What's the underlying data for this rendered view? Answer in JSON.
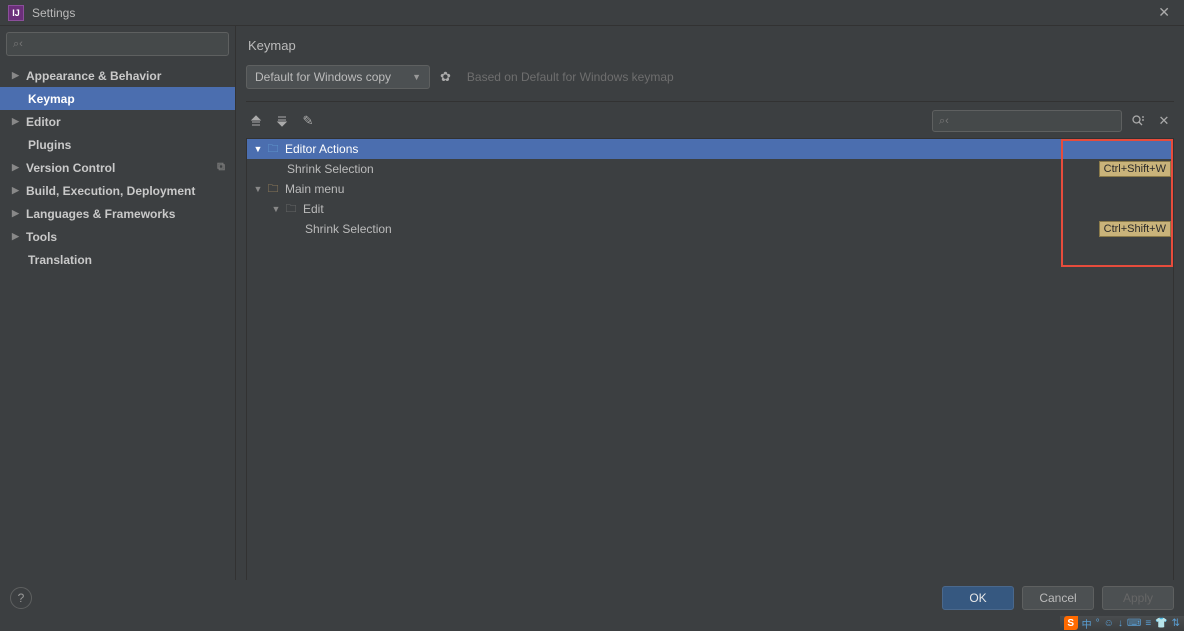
{
  "window": {
    "title": "Settings"
  },
  "sidebar": {
    "search_placeholder": "",
    "items": [
      {
        "label": "Appearance & Behavior",
        "bold": true,
        "arrow": true
      },
      {
        "label": "Keymap",
        "bold": true,
        "child": true,
        "selected": true
      },
      {
        "label": "Editor",
        "bold": true,
        "arrow": true
      },
      {
        "label": "Plugins",
        "bold": true,
        "child": true
      },
      {
        "label": "Version Control",
        "bold": true,
        "arrow": true,
        "copy": true
      },
      {
        "label": "Build, Execution, Deployment",
        "bold": true,
        "arrow": true
      },
      {
        "label": "Languages & Frameworks",
        "bold": true,
        "arrow": true
      },
      {
        "label": "Tools",
        "bold": true,
        "arrow": true
      },
      {
        "label": "Translation",
        "bold": true,
        "child": true
      }
    ]
  },
  "main": {
    "title": "Keymap",
    "scheme": "Default for Windows copy",
    "based_on": "Based on Default for Windows keymap",
    "search_placeholder": ""
  },
  "tree": {
    "rows": [
      {
        "label": "Editor Actions",
        "level": 0,
        "selected": true,
        "expanded": true,
        "icon": "folder-edit"
      },
      {
        "label": "Shrink Selection",
        "level": 1,
        "shortcut": "Ctrl+Shift+W"
      },
      {
        "label": "Main menu",
        "level": 0,
        "expanded": true,
        "icon": "folder"
      },
      {
        "label": "Edit",
        "level": 2,
        "expanded": true,
        "icon": "folder-plain"
      },
      {
        "label": "Shrink Selection",
        "level": 3,
        "shortcut": "Ctrl+Shift+W"
      }
    ]
  },
  "footer": {
    "ok": "OK",
    "cancel": "Cancel",
    "apply": "Apply"
  },
  "tray": {
    "items": [
      "中",
      "°",
      "☺",
      "↓",
      "⌨",
      "≡",
      "👕",
      "⇅"
    ]
  }
}
